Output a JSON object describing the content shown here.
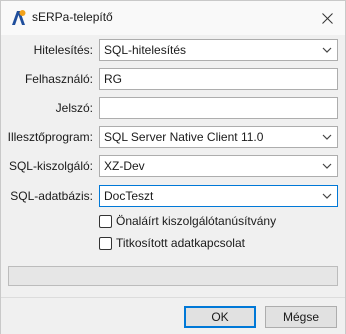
{
  "window": {
    "title": "sERPa-telepítő",
    "icon": "serpa-app-icon",
    "close_icon": "close-icon"
  },
  "form": {
    "authentication": {
      "label": "Hitelesítés:",
      "value": "SQL-hitelesítés",
      "control": "dropdown"
    },
    "username": {
      "label": "Felhasználó:",
      "value": "RG",
      "control": "text"
    },
    "password": {
      "label": "Jelszó:",
      "value": "",
      "control": "password"
    },
    "driver": {
      "label": "Illesztőprogram:",
      "value": "SQL Server Native Client 11.0",
      "control": "dropdown"
    },
    "server": {
      "label": "SQL-kiszolgáló:",
      "value": "XZ-Dev",
      "control": "dropdown"
    },
    "database": {
      "label": "SQL-adatbázis:",
      "value": "DocTeszt",
      "control": "dropdown",
      "focused": true
    }
  },
  "options": {
    "self_signed_cert": {
      "label": "Önaláírt kiszolgálótanúsítvány",
      "checked": false
    },
    "encrypted_connection": {
      "label": "Titkosított adatkapcsolat",
      "checked": false
    }
  },
  "progress": {
    "value": 0
  },
  "buttons": {
    "ok": "OK",
    "cancel": "Mégse"
  },
  "colors": {
    "accent": "#0078d7",
    "window_bg": "#f0f0f0",
    "field_border": "#adadad"
  }
}
